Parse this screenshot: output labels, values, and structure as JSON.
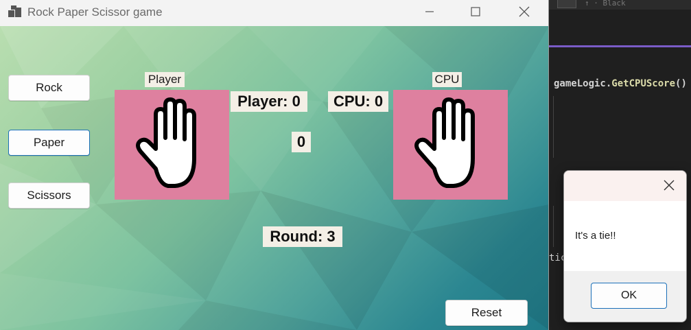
{
  "window": {
    "title": "Rock Paper Scissor game"
  },
  "controls": {
    "rock_label": "Rock",
    "paper_label": "Paper",
    "scissors_label": "Scissors",
    "reset_label": "Reset"
  },
  "board": {
    "player_label": "Player",
    "cpu_label": "CPU",
    "player_score": "Player: 0",
    "cpu_score": "CPU: 0",
    "result_value": "0",
    "round": "Round: 3",
    "player_choice_icon": "paper-hand-icon",
    "cpu_choice_icon": "paper-hand-icon",
    "hand_box_color": "#de809f"
  },
  "dialog": {
    "message": "It's a tie!!",
    "ok_label": "OK"
  },
  "editor": {
    "code_object": "gameLogic",
    "code_method": "GetCPUScore",
    "code_suffix": "()",
    "fragment": "tic",
    "tab_text": "↑ · Black"
  }
}
